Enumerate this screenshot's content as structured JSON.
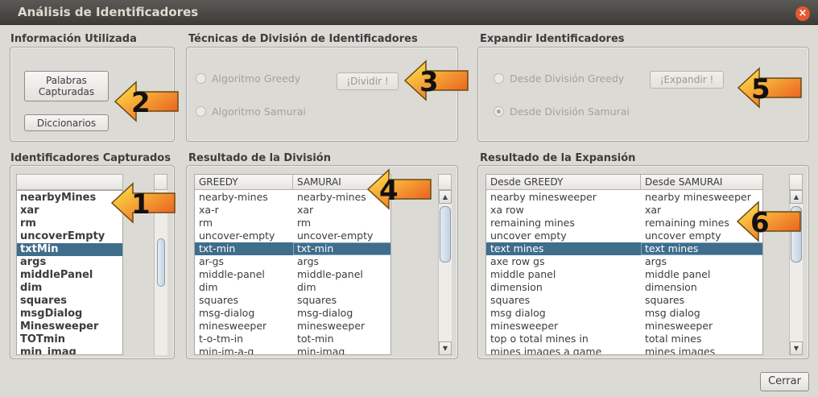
{
  "window": {
    "title": "Análisis de Identificadores",
    "close_glyph": "×"
  },
  "info": {
    "heading": "Información Utilizada",
    "btn_palabras": "Palabras\nCapturadas",
    "btn_diccionarios": "Diccionarios"
  },
  "tecnicas": {
    "heading": "Técnicas de División de Identificadores",
    "radio_greedy": "Algoritmo Greedy",
    "radio_samurai": "Algoritmo Samurai",
    "btn_dividir": "¡Dividir !",
    "greedy_selected": false,
    "samurai_selected": false
  },
  "expandir": {
    "heading": "Expandir Identificadores",
    "radio_greedy": "Desde División Greedy",
    "radio_samurai": "Desde División  Samurai",
    "btn_expandir": "¡Expandir !",
    "greedy_selected": false,
    "samurai_selected": true
  },
  "captured": {
    "heading": "Identificadores Capturados",
    "selected_index": 4,
    "items": [
      "nearbyMines",
      "xar",
      "rm",
      "uncoverEmpty",
      "txtMin",
      "args",
      "middlePanel",
      "dim",
      "squares",
      "msgDialog",
      "Minesweeper",
      "TOTmin",
      "min_imag"
    ]
  },
  "division": {
    "heading": "Resultado de la División",
    "col1": "GREEDY",
    "col2": "SAMURAI",
    "selected_index": 4,
    "rows": [
      [
        "nearby-mines",
        "nearby-mines"
      ],
      [
        "xa-r",
        "xar"
      ],
      [
        "rm",
        "rm"
      ],
      [
        "uncover-empty",
        "uncover-empty"
      ],
      [
        "txt-min",
        "txt-min"
      ],
      [
        "ar-gs",
        "args"
      ],
      [
        "middle-panel",
        "middle-panel"
      ],
      [
        "dim",
        "dim"
      ],
      [
        "squares",
        "squares"
      ],
      [
        "msg-dialog",
        "msg-dialog"
      ],
      [
        "minesweeper",
        "minesweeper"
      ],
      [
        "t-o-tm-in",
        "tot-min"
      ],
      [
        "min-im-a-g",
        "min-imag"
      ]
    ]
  },
  "expansion": {
    "heading": "Resultado de la Expansión",
    "col1": "Desde GREEDY",
    "col2": "Desde SAMURAI",
    "selected_index": 4,
    "rows": [
      [
        "nearby minesweeper",
        "nearby minesweeper"
      ],
      [
        "xa row",
        "xar"
      ],
      [
        "remaining mines",
        "remaining mines"
      ],
      [
        "uncover empty",
        "uncover empty"
      ],
      [
        "text mines",
        "text mines"
      ],
      [
        "axe row gs",
        "args"
      ],
      [
        "middle panel",
        "middle panel"
      ],
      [
        "dimension",
        "dimension"
      ],
      [
        "squares",
        "squares"
      ],
      [
        "msg dialog",
        "msg dialog"
      ],
      [
        "minesweeper",
        "minesweeper"
      ],
      [
        "top o total mines in",
        "total mines"
      ],
      [
        "mines images a game",
        "mines images"
      ]
    ]
  },
  "annotations": [
    "1",
    "2",
    "3",
    "4",
    "5",
    "6"
  ],
  "colors": {
    "selection": "#3f6d8c",
    "arrow_fill_start": "#ffe94d",
    "arrow_fill_end": "#e8501a",
    "titlebar": "#4a4945"
  },
  "icons": {
    "scroll_up": "▲",
    "scroll_down": "▼",
    "close": "close-icon"
  },
  "footer": {
    "btn_cerrar": "Cerrar"
  }
}
